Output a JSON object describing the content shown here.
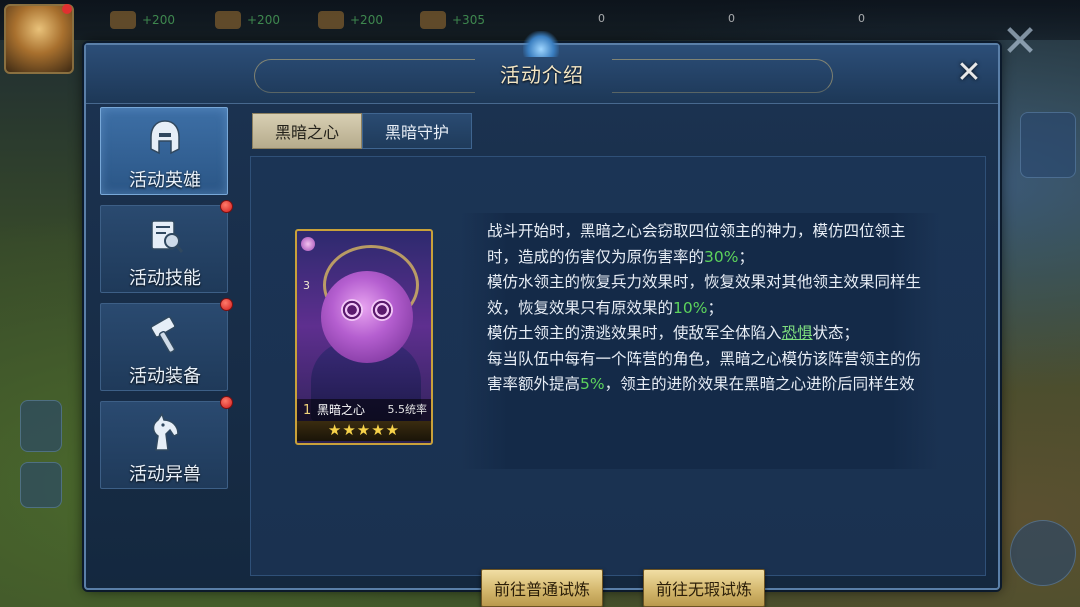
{
  "background": {
    "resources": [
      {
        "icon": "wood-icon",
        "value": "+200"
      },
      {
        "icon": "stone-icon",
        "value": "+200"
      },
      {
        "icon": "iron-icon",
        "value": "+200"
      },
      {
        "icon": "food-icon",
        "value": "+305"
      }
    ],
    "zero_values": [
      "0",
      "0",
      "0"
    ]
  },
  "dialog": {
    "title": "活动介绍",
    "close_icon": "close-icon"
  },
  "nav": {
    "items": [
      {
        "label": "活动英雄",
        "icon": "helmet-icon",
        "active": true,
        "badge": false
      },
      {
        "label": "活动技能",
        "icon": "scroll-magnifier-icon",
        "active": false,
        "badge": true
      },
      {
        "label": "活动装备",
        "icon": "hammer-icon",
        "active": false,
        "badge": true
      },
      {
        "label": "活动异兽",
        "icon": "horse-icon",
        "active": false,
        "badge": true
      }
    ]
  },
  "tabs": [
    {
      "label": "黑暗之心",
      "active": true
    },
    {
      "label": "黑暗守护",
      "active": false
    }
  ],
  "hero_card": {
    "rank": "1",
    "name": "黑暗之心",
    "stat": "5.5统率",
    "level_number": "3",
    "stars": "★★★★★",
    "star_count": 5
  },
  "description": {
    "p1_a": "战斗开始时，黑暗之心会窃取四位领主的神力，模仿四位领主时，造成的伤害仅为原伤害率的",
    "p1_value": "30%",
    "p1_b": "；",
    "p2_a": "模仿水领主的恢复兵力效果时，恢复效果对其他领主效果同样生效，恢复效果只有原效果的",
    "p2_value": "10%",
    "p2_b": "；",
    "p3_a": "模仿土领主的溃逃效果时，使敌军全体陷入",
    "p3_link": "恐惧",
    "p3_b": "状态；",
    "p4_a": "每当队伍中每有一个阵营的角色，黑暗之心模仿该阵营领主的伤害率额外提高",
    "p4_value": "5%",
    "p4_b": "，领主的进阶效果在黑暗之心进阶后同样生效"
  },
  "buttons": {
    "normal_trial": "前往普通试炼",
    "flawless_trial": "前往无瑕试炼"
  },
  "colors": {
    "highlight_green": "#5cd35c",
    "gold_button": "#d4b86e",
    "panel_blue": "#1b3455"
  }
}
